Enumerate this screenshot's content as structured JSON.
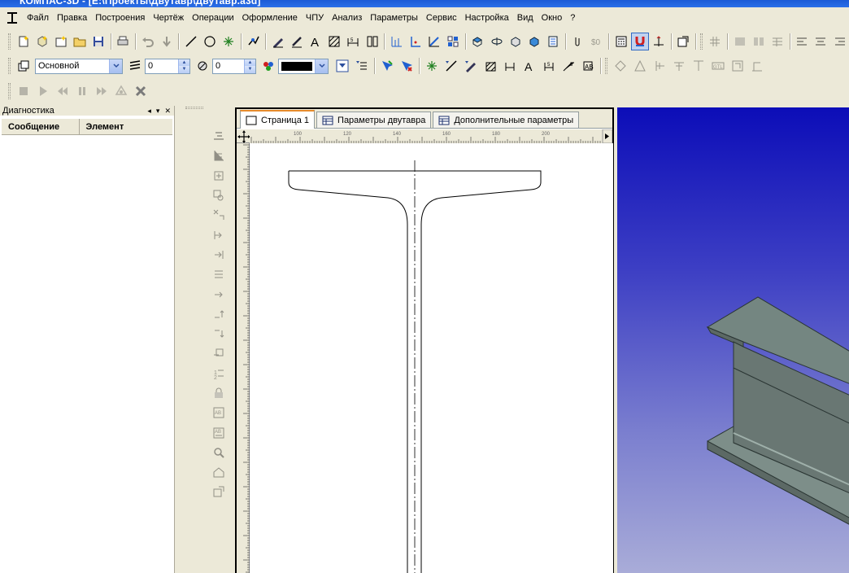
{
  "window": {
    "title": "КОМПАС-3D - [E:\\Проекты\\Двутавр\\Двутавр.a3d]"
  },
  "menu": [
    "Файл",
    "Правка",
    "Построения",
    "Чертёж",
    "Операции",
    "Оформление",
    "ЧПУ",
    "Анализ",
    "Параметры",
    "Сервис",
    "Настройка",
    "Вид",
    "Окно",
    "?"
  ],
  "properties": {
    "layer_style": "Основной",
    "line_width": "0",
    "layer_number": "0",
    "color": "#000000"
  },
  "diagnostics": {
    "title": "Диагностика",
    "columns": [
      "Сообщение",
      "Элемент"
    ]
  },
  "document": {
    "tabs": [
      "Страница 1",
      "Параметры двутавра",
      "Дополнительные параметры"
    ],
    "active_tab": 0,
    "ruler_labels": [
      "100",
      "120",
      "140",
      "160",
      "180",
      "200"
    ]
  },
  "colors": {
    "toolbar_bg": "#ece9d8",
    "viewport_top": "#0c0db8",
    "viewport_bottom": "#a9acd8",
    "beam_face": "#6c7874",
    "tab_accent": "#e68b2c"
  }
}
